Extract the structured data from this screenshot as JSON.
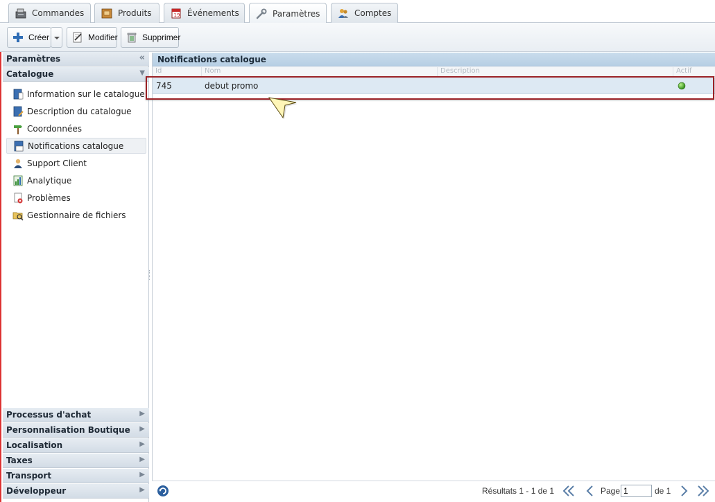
{
  "tabs": [
    {
      "label": "Commandes",
      "icon": "cash-register-icon"
    },
    {
      "label": "Produits",
      "icon": "product-box-icon"
    },
    {
      "label": "Événements",
      "icon": "calendar-icon"
    },
    {
      "label": "Paramètres",
      "icon": "wrench-icon",
      "active": true
    },
    {
      "label": "Comptes",
      "icon": "users-icon"
    }
  ],
  "toolbar": {
    "create_label": "Créer",
    "modify_label": "Modifier",
    "delete_label": "Supprimer"
  },
  "sidebar": {
    "title": "Paramètres",
    "collapse_glyph": "«",
    "section": "Catalogue",
    "items": [
      {
        "label": "Information sur le catalogue",
        "icon": "info-book-icon"
      },
      {
        "label": "Description du catalogue",
        "icon": "description-book-icon"
      },
      {
        "label": "Coordonnées",
        "icon": "signpost-icon"
      },
      {
        "label": "Notifications catalogue",
        "icon": "notification-icon",
        "selected": true
      },
      {
        "label": "Support Client",
        "icon": "support-person-icon"
      },
      {
        "label": "Analytique",
        "icon": "analytics-chart-icon"
      },
      {
        "label": "Problèmes",
        "icon": "problem-page-icon"
      },
      {
        "label": "Gestionnaire de fichiers",
        "icon": "file-manager-icon"
      }
    ],
    "sections_bottom": [
      "Processus d'achat",
      "Personnalisation Boutique",
      "Localisation",
      "Taxes",
      "Transport",
      "Développeur"
    ]
  },
  "main": {
    "title": "Notifications catalogue",
    "columns": [
      "Id",
      "Nom",
      "Description",
      "Actif"
    ],
    "rows": [
      {
        "id": "745",
        "name": "debut promo",
        "description": "",
        "active": true
      }
    ]
  },
  "footer": {
    "results": "Résultats 1 - 1 de 1",
    "page_label": "Page",
    "page_value": "1",
    "page_total": "de 1"
  },
  "colors": {
    "accent": "#b7cfe4",
    "highlight_border": "#9b2226",
    "status_active": "#3aa52a"
  }
}
